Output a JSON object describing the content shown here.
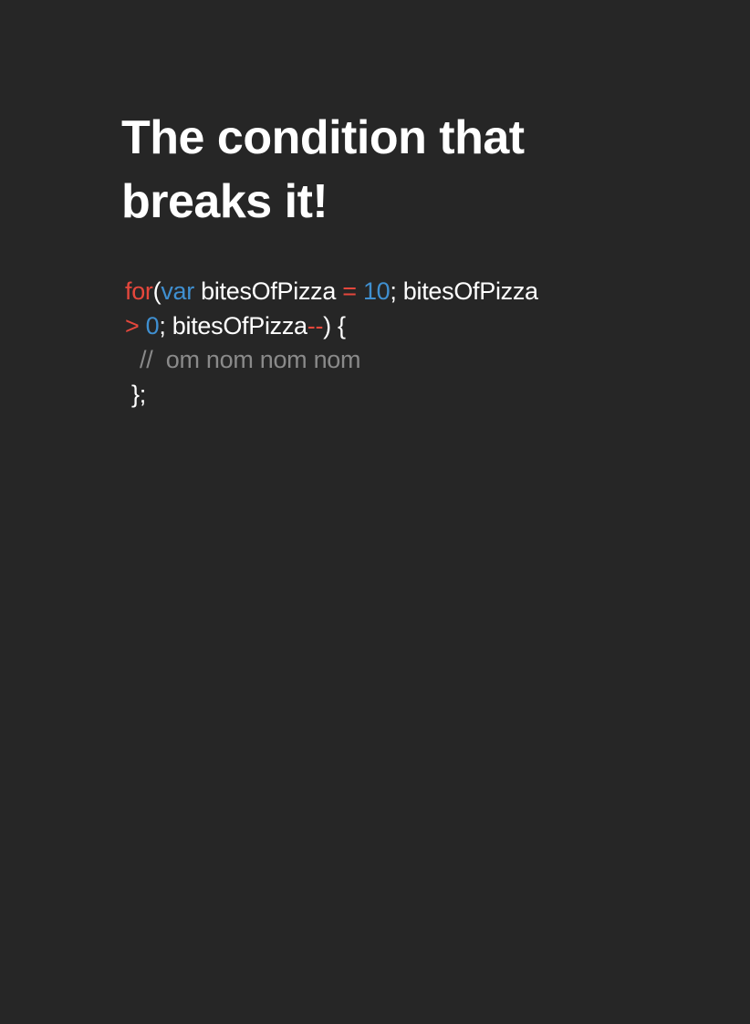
{
  "slide": {
    "title_line1": "The condition that",
    "title_line2": "breaks it!",
    "code": {
      "line1": {
        "kw_for": "for",
        "paren_open": "(",
        "kw_var": "var",
        "ident1": " bitesOfPizza ",
        "op_assign": "=",
        "space1": " ",
        "num_10": "10",
        "semi_ident": "; bitesOfPizza"
      },
      "line2": {
        "op_gt": ">",
        "space": " ",
        "num_0": "0",
        "semi_ident": "; bitesOfPizza",
        "op_dec": "--",
        "close": ") {"
      },
      "line3": {
        "comment": "//  om nom nom nom"
      },
      "line4": {
        "close": "};"
      }
    },
    "colors": {
      "background": "#262626",
      "keyword_red": "#e5473c",
      "keyword_blue": "#3f8fd0",
      "comment_gray": "#8a8a8a",
      "text_white": "#ffffff"
    }
  }
}
